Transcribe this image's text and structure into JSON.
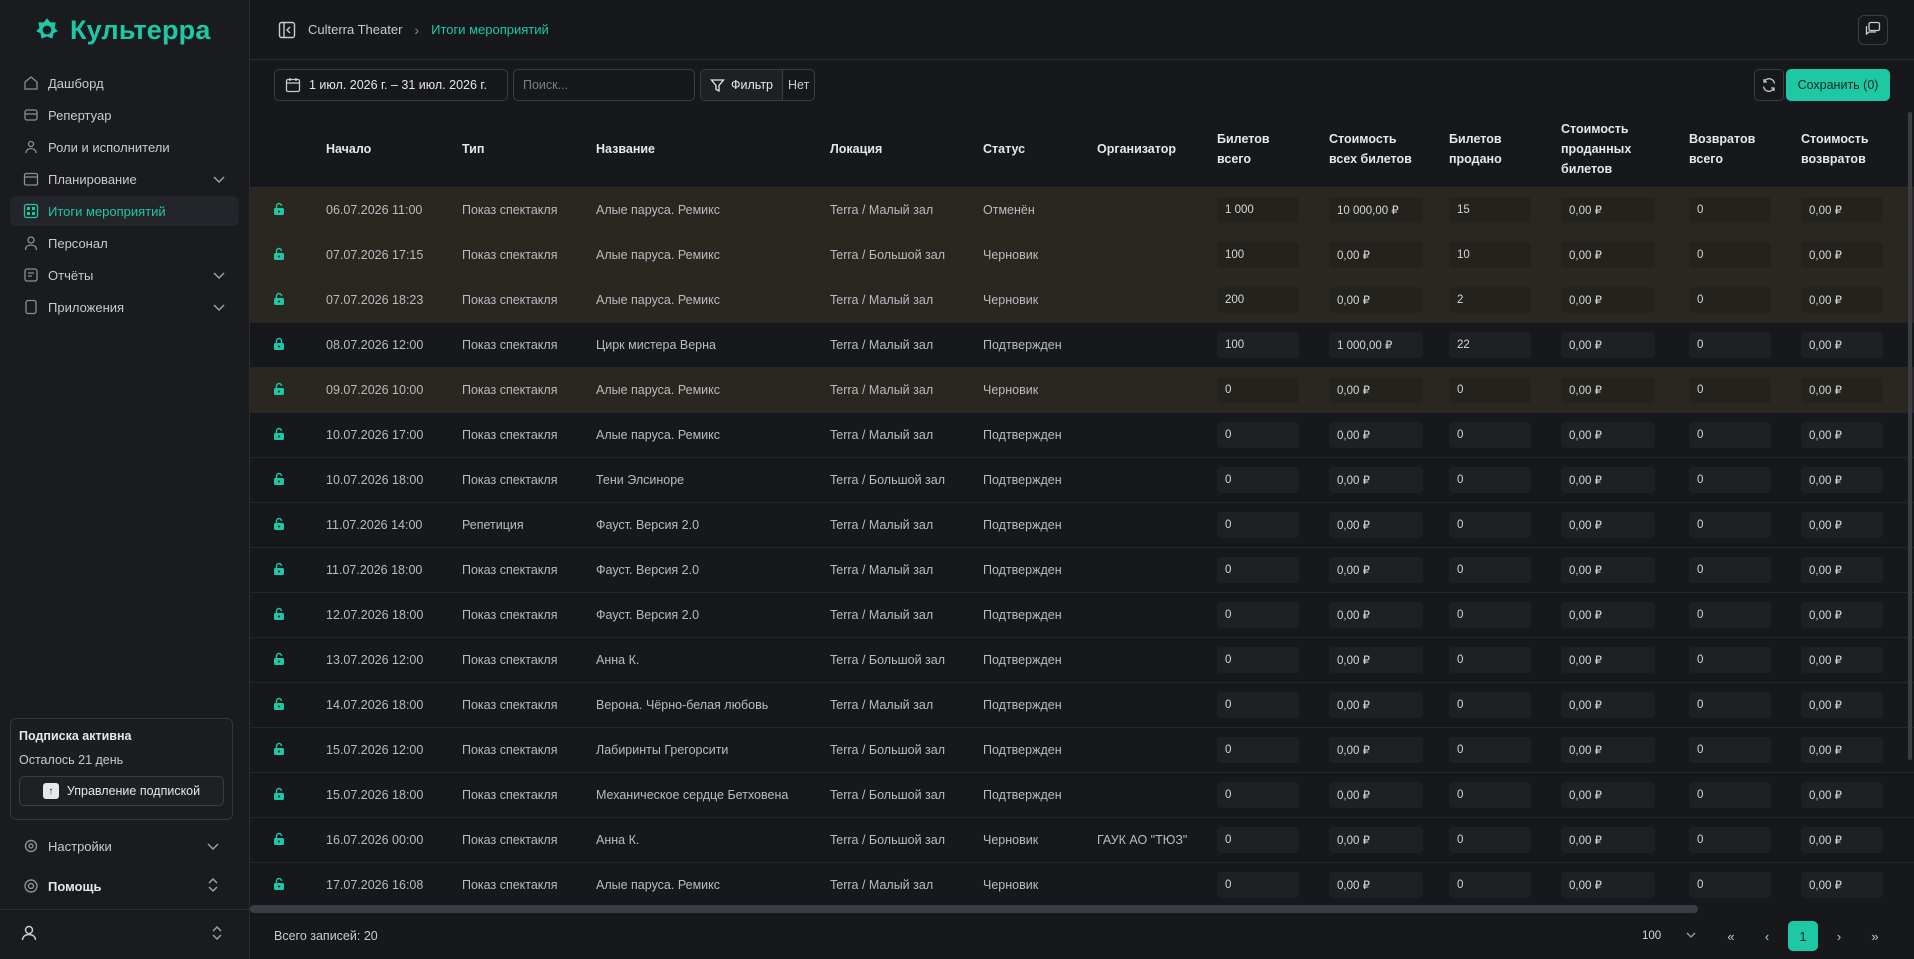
{
  "app": {
    "name": "Культерра",
    "accent": "#1ec8a5"
  },
  "sidebar": {
    "items": [
      {
        "label": "Дашборд",
        "icon": "home-icon",
        "active": false,
        "expandable": false
      },
      {
        "label": "Репертуар",
        "icon": "theater-icon",
        "active": false,
        "expandable": false
      },
      {
        "label": "Роли и исполнители",
        "icon": "users-icon",
        "active": false,
        "expandable": false
      },
      {
        "label": "Планирование",
        "icon": "calendar-icon",
        "active": false,
        "expandable": true
      },
      {
        "label": "Итоги мероприятий",
        "icon": "grid-icon",
        "active": true,
        "expandable": false
      },
      {
        "label": "Персонал",
        "icon": "person-icon",
        "active": false,
        "expandable": false
      },
      {
        "label": "Отчёты",
        "icon": "report-icon",
        "active": false,
        "expandable": true
      },
      {
        "label": "Приложения",
        "icon": "apps-icon",
        "active": false,
        "expandable": true
      }
    ],
    "subscription": {
      "title": "Подписка активна",
      "days_left": "Осталось 21 день",
      "manage_label": "Управление подпиской"
    },
    "settings_label": "Настройки",
    "help_label": "Помощь"
  },
  "breadcrumb": {
    "org": "Culterra Theater",
    "current": "Итоги мероприятий"
  },
  "toolbar": {
    "date_range": "1 июл. 2026 г. – 31 июл. 2026 г.",
    "search_placeholder": "Поиск...",
    "filter_label": "Фильтр",
    "filter_value": "Нет",
    "save_label": "Сохранить (0)"
  },
  "table": {
    "headers": {
      "start": "Начало",
      "type": "Тип",
      "name": "Название",
      "location": "Локация",
      "status": "Статус",
      "organizer": "Организатор",
      "tickets_total_1": "Билетов",
      "tickets_total_2": "всего",
      "cost_all_1": "Стоимость",
      "cost_all_2": "всех билетов",
      "sold_1": "Билетов",
      "sold_2": "продано",
      "cost_sold_1": "Стоимость",
      "cost_sold_2": "проданных",
      "cost_sold_3": "билетов",
      "returns_1": "Возвратов",
      "returns_2": "всего",
      "cost_returns_1": "Стоимость",
      "cost_returns_2": "возвратов"
    },
    "rows": [
      {
        "start": "06.07.2026 11:00",
        "type": "Показ спектакля",
        "name": "Алые паруса. Ремикс",
        "location": "Terra / Малый зал",
        "status": "Отменён",
        "organizer": "",
        "tickets_total": "1 000",
        "cost_all": "10 000,00 ₽",
        "sold": "15",
        "cost_sold": "0,00 ₽",
        "returns": "0",
        "cost_returns": "0,00 ₽",
        "warn": true,
        "locked": false
      },
      {
        "start": "07.07.2026 17:15",
        "type": "Показ спектакля",
        "name": "Алые паруса. Ремикс",
        "location": "Terra / Большой зал",
        "status": "Черновик",
        "organizer": "",
        "tickets_total": "100",
        "cost_all": "0,00 ₽",
        "sold": "10",
        "cost_sold": "0,00 ₽",
        "returns": "0",
        "cost_returns": "0,00 ₽",
        "warn": true,
        "locked": false
      },
      {
        "start": "07.07.2026 18:23",
        "type": "Показ спектакля",
        "name": "Алые паруса. Ремикс",
        "location": "Terra / Малый зал",
        "status": "Черновик",
        "organizer": "",
        "tickets_total": "200",
        "cost_all": "0,00 ₽",
        "sold": "2",
        "cost_sold": "0,00 ₽",
        "returns": "0",
        "cost_returns": "0,00 ₽",
        "warn": true,
        "locked": false
      },
      {
        "start": "08.07.2026 12:00",
        "type": "Показ спектакля",
        "name": "Цирк мистера Верна",
        "location": "Terra / Малый зал",
        "status": "Подтвержден",
        "organizer": "",
        "tickets_total": "100",
        "cost_all": "1 000,00 ₽",
        "sold": "22",
        "cost_sold": "0,00 ₽",
        "returns": "0",
        "cost_returns": "0,00 ₽",
        "warn": false,
        "locked": true
      },
      {
        "start": "09.07.2026 10:00",
        "type": "Показ спектакля",
        "name": "Алые паруса. Ремикс",
        "location": "Terra / Малый зал",
        "status": "Черновик",
        "organizer": "",
        "tickets_total": "0",
        "cost_all": "0,00 ₽",
        "sold": "0",
        "cost_sold": "0,00 ₽",
        "returns": "0",
        "cost_returns": "0,00 ₽",
        "warn": true,
        "locked": false
      },
      {
        "start": "10.07.2026 17:00",
        "type": "Показ спектакля",
        "name": "Алые паруса. Ремикс",
        "location": "Terra / Малый зал",
        "status": "Подтвержден",
        "organizer": "",
        "tickets_total": "0",
        "cost_all": "0,00 ₽",
        "sold": "0",
        "cost_sold": "0,00 ₽",
        "returns": "0",
        "cost_returns": "0,00 ₽",
        "warn": false,
        "locked": false
      },
      {
        "start": "10.07.2026 18:00",
        "type": "Показ спектакля",
        "name": "Тени Элсиноре",
        "location": "Terra / Большой зал",
        "status": "Подтвержден",
        "organizer": "",
        "tickets_total": "0",
        "cost_all": "0,00 ₽",
        "sold": "0",
        "cost_sold": "0,00 ₽",
        "returns": "0",
        "cost_returns": "0,00 ₽",
        "warn": false,
        "locked": false
      },
      {
        "start": "11.07.2026 14:00",
        "type": "Репетиция",
        "name": "Фауст. Версия 2.0",
        "location": "Terra / Малый зал",
        "status": "Подтвержден",
        "organizer": "",
        "tickets_total": "0",
        "cost_all": "0,00 ₽",
        "sold": "0",
        "cost_sold": "0,00 ₽",
        "returns": "0",
        "cost_returns": "0,00 ₽",
        "warn": false,
        "locked": false
      },
      {
        "start": "11.07.2026 18:00",
        "type": "Показ спектакля",
        "name": "Фауст. Версия 2.0",
        "location": "Terra / Малый зал",
        "status": "Подтвержден",
        "organizer": "",
        "tickets_total": "0",
        "cost_all": "0,00 ₽",
        "sold": "0",
        "cost_sold": "0,00 ₽",
        "returns": "0",
        "cost_returns": "0,00 ₽",
        "warn": false,
        "locked": false
      },
      {
        "start": "12.07.2026 18:00",
        "type": "Показ спектакля",
        "name": "Фауст. Версия 2.0",
        "location": "Terra / Малый зал",
        "status": "Подтвержден",
        "organizer": "",
        "tickets_total": "0",
        "cost_all": "0,00 ₽",
        "sold": "0",
        "cost_sold": "0,00 ₽",
        "returns": "0",
        "cost_returns": "0,00 ₽",
        "warn": false,
        "locked": false
      },
      {
        "start": "13.07.2026 12:00",
        "type": "Показ спектакля",
        "name": "Анна К.",
        "location": "Terra / Большой зал",
        "status": "Подтвержден",
        "organizer": "",
        "tickets_total": "0",
        "cost_all": "0,00 ₽",
        "sold": "0",
        "cost_sold": "0,00 ₽",
        "returns": "0",
        "cost_returns": "0,00 ₽",
        "warn": false,
        "locked": false
      },
      {
        "start": "14.07.2026 18:00",
        "type": "Показ спектакля",
        "name": "Верона. Чёрно-белая любовь",
        "location": "Terra / Малый зал",
        "status": "Подтвержден",
        "organizer": "",
        "tickets_total": "0",
        "cost_all": "0,00 ₽",
        "sold": "0",
        "cost_sold": "0,00 ₽",
        "returns": "0",
        "cost_returns": "0,00 ₽",
        "warn": false,
        "locked": false
      },
      {
        "start": "15.07.2026 12:00",
        "type": "Показ спектакля",
        "name": "Лабиринты Грегорсити",
        "location": "Terra / Большой зал",
        "status": "Подтвержден",
        "organizer": "",
        "tickets_total": "0",
        "cost_all": "0,00 ₽",
        "sold": "0",
        "cost_sold": "0,00 ₽",
        "returns": "0",
        "cost_returns": "0,00 ₽",
        "warn": false,
        "locked": false
      },
      {
        "start": "15.07.2026 18:00",
        "type": "Показ спектакля",
        "name": "Механическое сердце Бетховена",
        "location": "Terra / Большой зал",
        "status": "Подтвержден",
        "organizer": "",
        "tickets_total": "0",
        "cost_all": "0,00 ₽",
        "sold": "0",
        "cost_sold": "0,00 ₽",
        "returns": "0",
        "cost_returns": "0,00 ₽",
        "warn": false,
        "locked": false
      },
      {
        "start": "16.07.2026 00:00",
        "type": "Показ спектакля",
        "name": "Анна К.",
        "location": "Terra / Большой зал",
        "status": "Черновик",
        "organizer": "ГАУК АО \"ТЮЗ\"",
        "tickets_total": "0",
        "cost_all": "0,00 ₽",
        "sold": "0",
        "cost_sold": "0,00 ₽",
        "returns": "0",
        "cost_returns": "0,00 ₽",
        "warn": false,
        "locked": false
      },
      {
        "start": "17.07.2026 16:08",
        "type": "Показ спектакля",
        "name": "Алые паруса. Ремикс",
        "location": "Terra / Малый зал",
        "status": "Черновик",
        "organizer": "",
        "tickets_total": "0",
        "cost_all": "0,00 ₽",
        "sold": "0",
        "cost_sold": "0,00 ₽",
        "returns": "0",
        "cost_returns": "0,00 ₽",
        "warn": false,
        "locked": false
      }
    ]
  },
  "footer": {
    "total": "Всего записей: 20",
    "page_size": "100",
    "current_page": "1"
  }
}
